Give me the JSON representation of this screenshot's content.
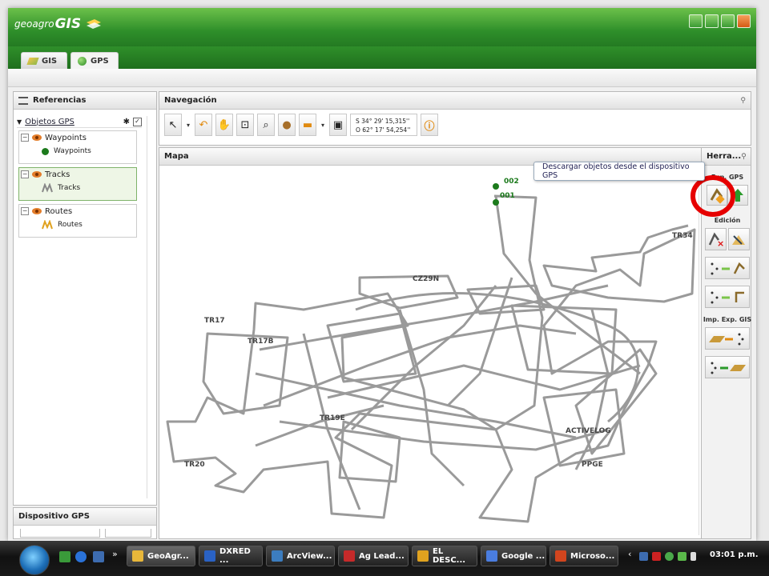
{
  "app": {
    "logo_prefix": "geoagro",
    "logo_name": "GIS"
  },
  "tabs": [
    {
      "label": "GIS"
    },
    {
      "label": "GPS"
    }
  ],
  "referencias": {
    "title": "Referencias",
    "group_label": "Objetos GPS",
    "layers": [
      {
        "name": "Waypoints",
        "legend": "Waypoints"
      },
      {
        "name": "Tracks",
        "legend": "Tracks"
      },
      {
        "name": "Routes",
        "legend": "Routes"
      }
    ]
  },
  "dispositivo": {
    "title": "Dispositivo GPS"
  },
  "navegacion": {
    "title": "Navegación",
    "coord_lat": "S 34° 29' 15,315''",
    "coord_lon": "O 62° 17' 54,254''"
  },
  "mapa": {
    "title": "Mapa",
    "labels": [
      "002",
      "001",
      "TR34",
      "CZ29N",
      "TR17",
      "TR17B",
      "TR19E",
      "ACTIVELOG",
      "TR20",
      "PPGE"
    ]
  },
  "herramientas": {
    "title": "Herra...",
    "sections": {
      "exp_gps": "Exp. GPS",
      "edicion": "Edición",
      "imp_exp_gis": "Imp. Exp. GIS"
    },
    "tooltip": "Descargar objetos desde el dispositivo GPS"
  },
  "taskbar": {
    "buttons": [
      {
        "label": "GeoAgr...",
        "color": "#e8b73a"
      },
      {
        "label": "DXRED ...",
        "color": "#2a62c4"
      },
      {
        "label": "ArcView...",
        "color": "#3c7dbf"
      },
      {
        "label": "Ag Lead...",
        "color": "#c62a2a"
      },
      {
        "label": "EL DESC...",
        "color": "#e0a21f"
      },
      {
        "label": "Google ...",
        "color": "#4a7de0"
      },
      {
        "label": "Microso...",
        "color": "#d2451e"
      }
    ],
    "clock": "03:01 p.m."
  },
  "colors": {
    "accent_green": "#2e8f2a",
    "highlight_red": "#e60000",
    "track_gray": "#9a9a9a"
  }
}
